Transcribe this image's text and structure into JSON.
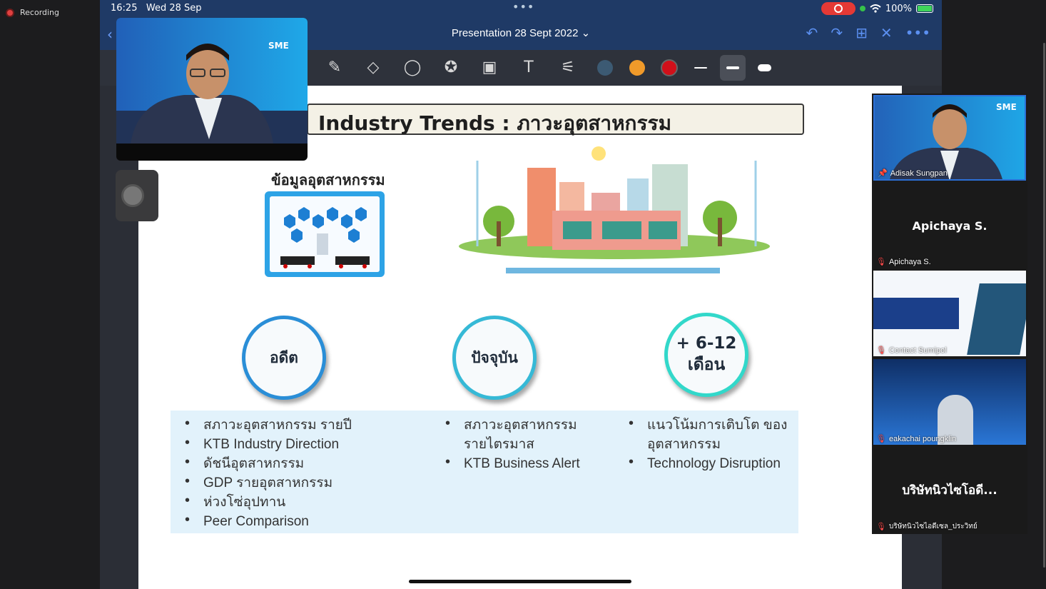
{
  "recording": {
    "label": "Recording"
  },
  "status": {
    "time": "16:25",
    "date": "Wed 28 Sep",
    "dots": "•••",
    "battery": "100%"
  },
  "nav": {
    "title": "Presentation 28 Sept 2022 ⌄"
  },
  "toolbar": {
    "colors": [
      "#3c5a73",
      "#f09a2a",
      "#d0101a"
    ]
  },
  "slide": {
    "title": "Industry Trends : ภาวะอุตสาหกรรม",
    "subhead": "ข้อมูลอุตสาหกรรม",
    "circles": [
      {
        "label": "อดีต"
      },
      {
        "label": "ปัจจุบัน"
      },
      {
        "line1": "+ 6-12",
        "line2": "เดือน"
      }
    ],
    "col1": [
      "สภาวะอุตสาหกรรม รายปี",
      "KTB Industry Direction",
      "ดัชนีอุตสาหกรรม",
      "GDP รายอุตสาหกรรม",
      "ห่วงโซ่อุปทาน",
      "Peer Comparison"
    ],
    "col2": [
      "สภาวะอุตสาหกรรม รายไตรมาส",
      "KTB Business Alert"
    ],
    "col3": [
      "แนวโน้มการเติบโต ของอุตสาหกรรม",
      "Technology Disruption"
    ]
  },
  "participants": [
    {
      "name": "Adisak Sungpan"
    },
    {
      "name": "Apichaya S.",
      "big": "Apichaya S."
    },
    {
      "name": "Contact Sumipol"
    },
    {
      "name": "eakachai poungklin"
    },
    {
      "name": "บริษัทนิวไซไอดีเซล_ประวิทย์",
      "big": "บริษัทนิวไซโอดี..."
    }
  ],
  "brand": {
    "sme": "SME"
  }
}
